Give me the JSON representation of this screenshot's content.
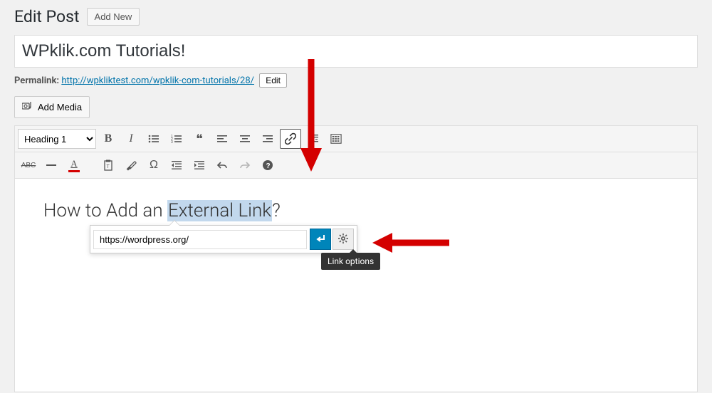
{
  "header": {
    "page_title": "Edit Post",
    "add_new_label": "Add New"
  },
  "post": {
    "title_value": "WPklik.com Tutorials!",
    "permalink_label": "Permalink:",
    "permalink_base": "http://wpkliktest.com/",
    "permalink_slug": "wpklik-com-tutorials",
    "permalink_id": "/28/",
    "permalink_edit_label": "Edit"
  },
  "media": {
    "add_media_label": "Add Media"
  },
  "toolbar": {
    "format_value": "Heading 1"
  },
  "content": {
    "heading_before": "How to Add an ",
    "heading_highlight": "External Link",
    "heading_after": "?"
  },
  "link_popup": {
    "url_value": "https://wordpress.org/",
    "tooltip_text": "Link options"
  }
}
